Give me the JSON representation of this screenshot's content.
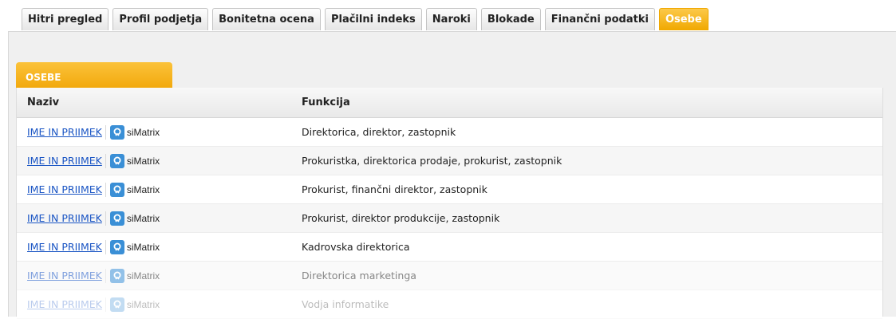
{
  "tabs": [
    {
      "label": "Hitri pregled",
      "active": false
    },
    {
      "label": "Profil podjetja",
      "active": false
    },
    {
      "label": "Bonitetna ocena",
      "active": false
    },
    {
      "label": "Plačilni indeks",
      "active": false
    },
    {
      "label": "Naroki",
      "active": false
    },
    {
      "label": "Blokade",
      "active": false
    },
    {
      "label": "Finančni podatki",
      "active": false
    },
    {
      "label": "Osebe",
      "active": true
    }
  ],
  "section": {
    "title": "OSEBE"
  },
  "table": {
    "headers": {
      "name": "Naziv",
      "function": "Funkcija"
    },
    "rows": [
      {
        "name": "IME IN PRIIMEK",
        "link": "siMatrix",
        "function": "Direktorica, direktor, zastopnik"
      },
      {
        "name": "IME IN PRIIMEK",
        "link": "siMatrix",
        "function": "Prokuristka, direktorica prodaje, prokurist, zastopnik"
      },
      {
        "name": "IME IN PRIIMEK",
        "link": "siMatrix",
        "function": "Prokurist, finančni direktor, zastopnik"
      },
      {
        "name": "IME IN PRIIMEK",
        "link": "siMatrix",
        "function": "Prokurist, direktor produkcije, zastopnik"
      },
      {
        "name": "IME IN PRIIMEK",
        "link": "siMatrix",
        "function": "Kadrovska direktorica"
      },
      {
        "name": "IME IN PRIIMEK",
        "link": "siMatrix",
        "function": "Direktorica marketinga"
      },
      {
        "name": "IME IN PRIIMEK",
        "link": "siMatrix",
        "function": "Vodja informatike"
      }
    ]
  },
  "colors": {
    "accent": "#f5b011",
    "link": "#1a55c4",
    "simatrix": "#3a8fd6"
  },
  "icons": {
    "simatrix": "simatrix-icon"
  }
}
